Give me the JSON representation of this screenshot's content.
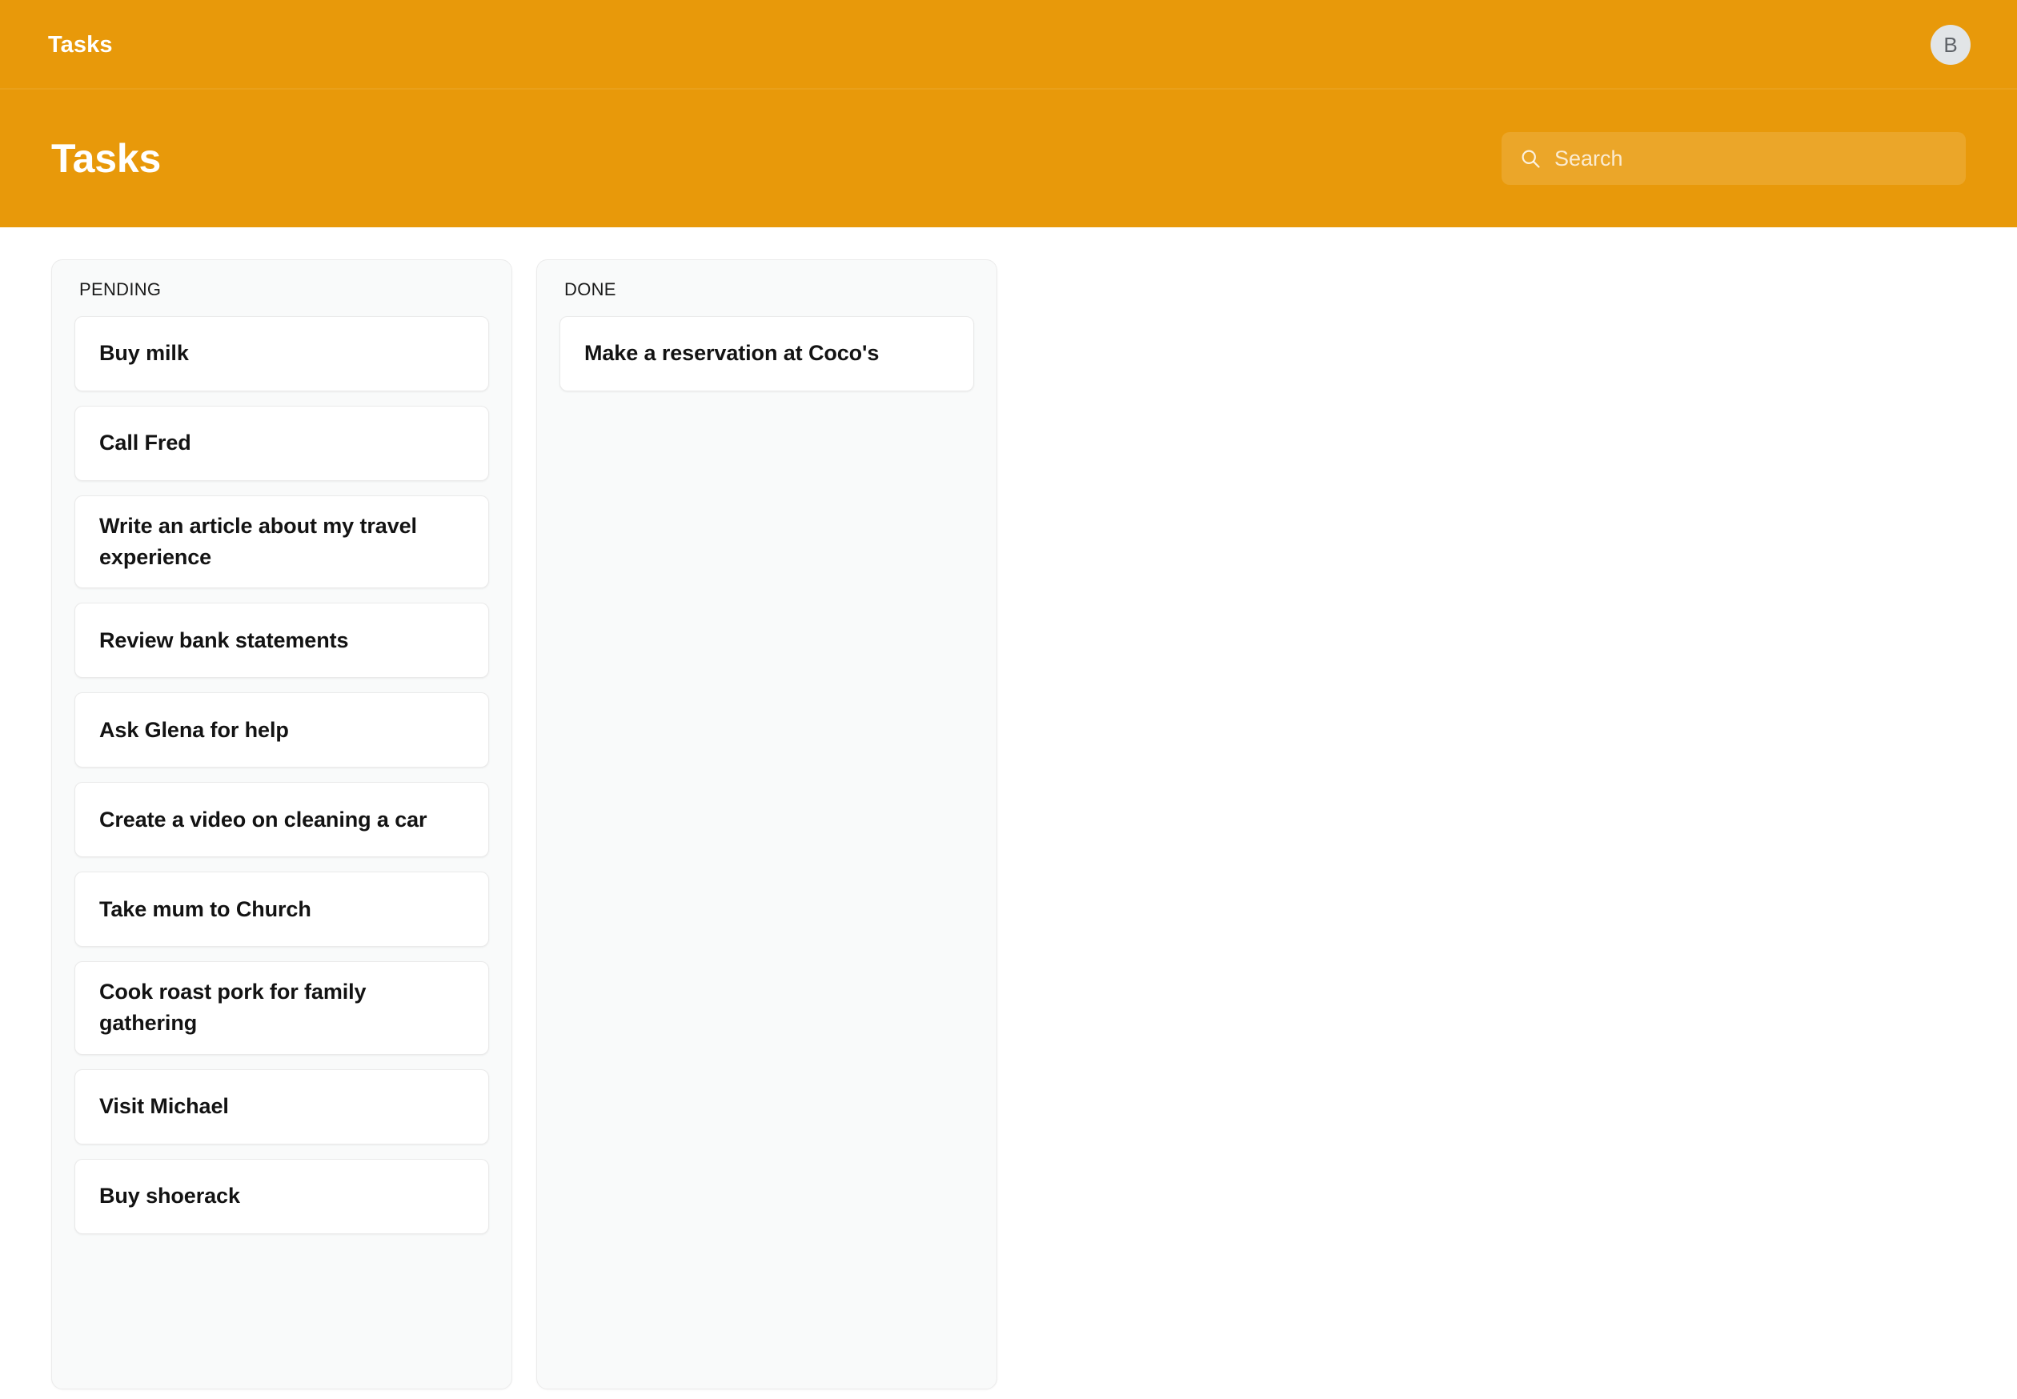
{
  "topbar": {
    "app_title": "Tasks",
    "avatar_initial": "B"
  },
  "header": {
    "page_title": "Tasks",
    "search": {
      "value": "",
      "placeholder": "Search",
      "icon": "search-icon"
    }
  },
  "colors": {
    "brand_orange": "#e8990a",
    "page_background": "#ffffff",
    "column_background": "#f9fafa",
    "card_background": "#ffffff",
    "card_border": "#eaeaea",
    "avatar_background": "#e2e5e7",
    "text_primary": "#131313"
  },
  "board": {
    "columns": [
      {
        "id": "pending",
        "title": "PENDING",
        "cards": [
          {
            "text": "Buy milk"
          },
          {
            "text": "Call Fred"
          },
          {
            "text": "Write an article about my travel experience"
          },
          {
            "text": "Review bank statements"
          },
          {
            "text": "Ask Glena for help"
          },
          {
            "text": "Create a video on cleaning a car"
          },
          {
            "text": "Take mum to Church"
          },
          {
            "text": "Cook roast pork for family gathering"
          },
          {
            "text": "Visit Michael"
          },
          {
            "text": "Buy shoerack"
          }
        ]
      },
      {
        "id": "done",
        "title": "DONE",
        "cards": [
          {
            "text": "Make a reservation at Coco's"
          }
        ]
      }
    ]
  }
}
